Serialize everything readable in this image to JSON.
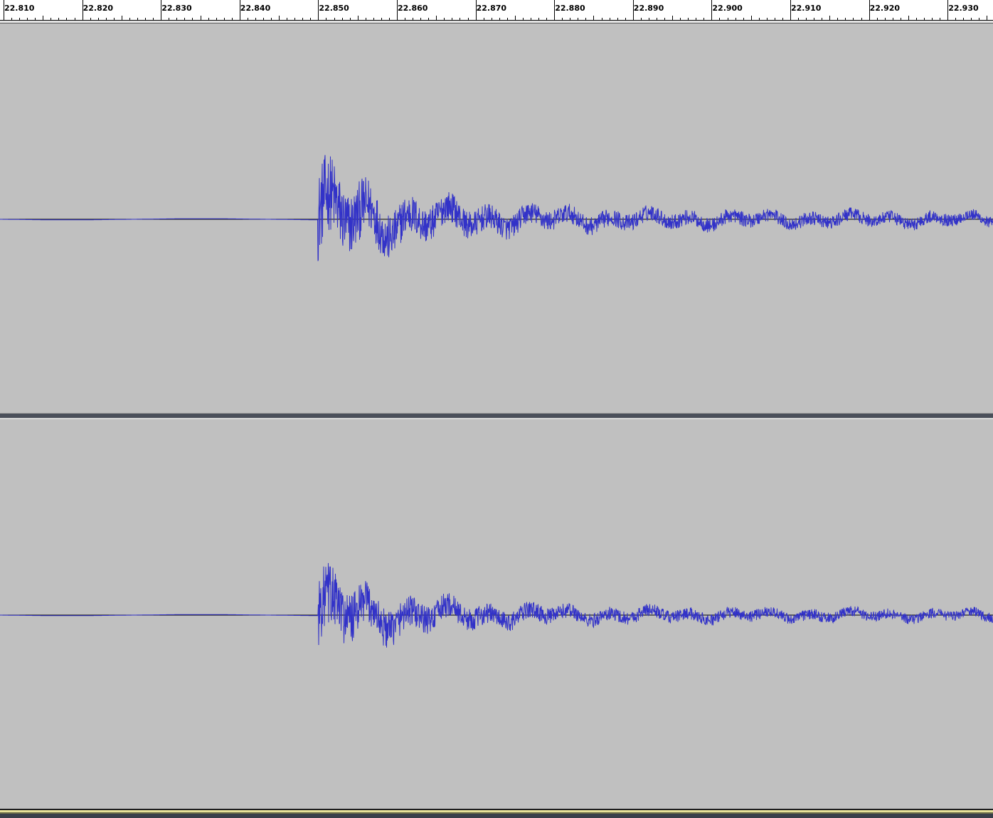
{
  "ruler": {
    "labels": [
      "22.810",
      "22.820",
      "22.830",
      "22.840",
      "22.850",
      "22.860",
      "22.870",
      "22.880",
      "22.890",
      "22.900",
      "22.910",
      "22.920",
      "22.930"
    ]
  },
  "colors": {
    "track_background": "#c0c0c0",
    "waveform": "#3232c8",
    "zero_line": "#000000",
    "ruler_background": "#ffffff"
  },
  "tracks": [
    {
      "channel": "left",
      "onset_time": 22.848,
      "end_time": 22.936
    },
    {
      "channel": "right",
      "onset_time": 22.848,
      "end_time": 22.936
    }
  ]
}
